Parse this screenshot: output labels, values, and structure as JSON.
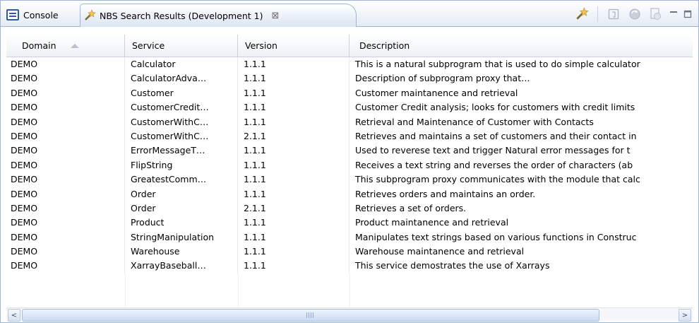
{
  "tabs": {
    "console_label": "Console",
    "active_label": "NBS Search Results (Development 1)",
    "close_glyph": "⊠"
  },
  "icons": {
    "console": "console-icon",
    "search_results": "magic-wand-icon",
    "toolbar_search": "magic-wand-icon",
    "toolbar_save": "document-icon",
    "toolbar_refresh": "refresh-icon",
    "toolbar_stop": "stop-icon",
    "minimize": "minimize-icon",
    "maximize": "maximize-icon"
  },
  "table": {
    "columns": [
      "Domain",
      "Service",
      "Version",
      "Description"
    ],
    "rows": [
      {
        "domain": "DEMO",
        "service": "Calculator",
        "version": "1.1.1",
        "description": "This is a natural subprogram that is used to do simple calculator"
      },
      {
        "domain": "DEMO",
        "service": "CalculatorAdva…",
        "version": "1.1.1",
        "description": "Description of subprogram proxy that…"
      },
      {
        "domain": "DEMO",
        "service": "Customer",
        "version": "1.1.1",
        "description": "Customer maintanence and retrieval"
      },
      {
        "domain": "DEMO",
        "service": "CustomerCredit…",
        "version": "1.1.1",
        "description": "Customer Credit analysis; looks for customers with credit limits"
      },
      {
        "domain": "DEMO",
        "service": "CustomerWithC…",
        "version": "1.1.1",
        "description": "Retrieval and Maintenance of Customer with Contacts"
      },
      {
        "domain": "DEMO",
        "service": "CustomerWithC…",
        "version": "2.1.1",
        "description": "Retrieves and maintains a set of customers and their contact in"
      },
      {
        "domain": "DEMO",
        "service": "ErrorMessageT…",
        "version": "1.1.1",
        "description": "Used to reverese text and trigger Natural error messages for t"
      },
      {
        "domain": "DEMO",
        "service": "FlipString",
        "version": "1.1.1",
        "description": "Receives a text string and reverses the order of characters (ab"
      },
      {
        "domain": "DEMO",
        "service": "GreatestComm…",
        "version": "1.1.1",
        "description": "This subprogram proxy communicates with the module that calc"
      },
      {
        "domain": "DEMO",
        "service": "Order",
        "version": "1.1.1",
        "description": "Retrieves orders and maintains an order."
      },
      {
        "domain": "DEMO",
        "service": "Order",
        "version": "2.1.1",
        "description": "Retrieves a set of orders."
      },
      {
        "domain": "DEMO",
        "service": "Product",
        "version": "1.1.1",
        "description": "Product maintanence and retrieval"
      },
      {
        "domain": "DEMO",
        "service": "StringManipulation",
        "version": "1.1.1",
        "description": "Manipulates text strings based on various functions in Construc"
      },
      {
        "domain": "DEMO",
        "service": "Warehouse",
        "version": "1.1.1",
        "description": "Warehouse maintanence and retrieval"
      },
      {
        "domain": "DEMO",
        "service": "XarrayBaseball…",
        "version": "1.1.1",
        "description": "This service demostrates the use of Xarrays"
      }
    ]
  },
  "scrollbar": {
    "left_arrow": "<",
    "right_arrow": ">"
  },
  "colors": {
    "border": "#9fb5d2",
    "console_icon": "#2f5aa8"
  }
}
